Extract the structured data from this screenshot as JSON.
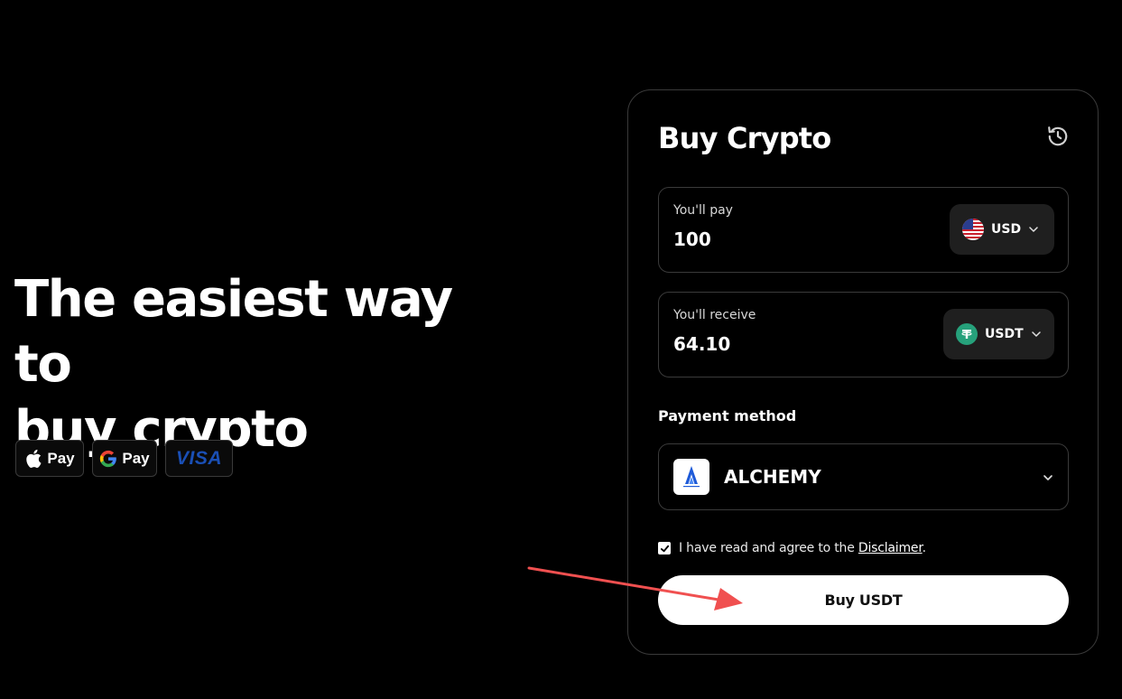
{
  "hero": {
    "title_line1": "The easiest way to",
    "title_line2": "buy crypto",
    "payment_badges": [
      {
        "icon": "apple-icon",
        "label": "Pay"
      },
      {
        "icon": "google-icon",
        "label": "Pay"
      },
      {
        "icon": "visa-logo",
        "label": "VISA"
      }
    ]
  },
  "card": {
    "title": "Buy Crypto",
    "history_icon": "history-icon",
    "pay": {
      "label": "You'll pay",
      "value": "100",
      "currency": "USD",
      "currency_icon": "us-flag-icon"
    },
    "receive": {
      "label": "You'll receive",
      "value": "64.10",
      "currency": "USDT",
      "currency_icon": "tether-icon"
    },
    "payment_method": {
      "label": "Payment method",
      "selected": "ALCHEMY",
      "logo": "alchemy-pay-logo"
    },
    "agreement": {
      "checked": true,
      "text_before": "I have read and agree to the ",
      "link_text": "Disclaimer",
      "text_after": "."
    },
    "buy_button_label": "Buy USDT"
  },
  "colors": {
    "background": "#000000",
    "card_border": "#3a3a3a",
    "select_bg": "#1f1f1f",
    "tether_green": "#26a17b",
    "visa_blue": "#1a4fb5",
    "annotation_red": "#f05050"
  }
}
